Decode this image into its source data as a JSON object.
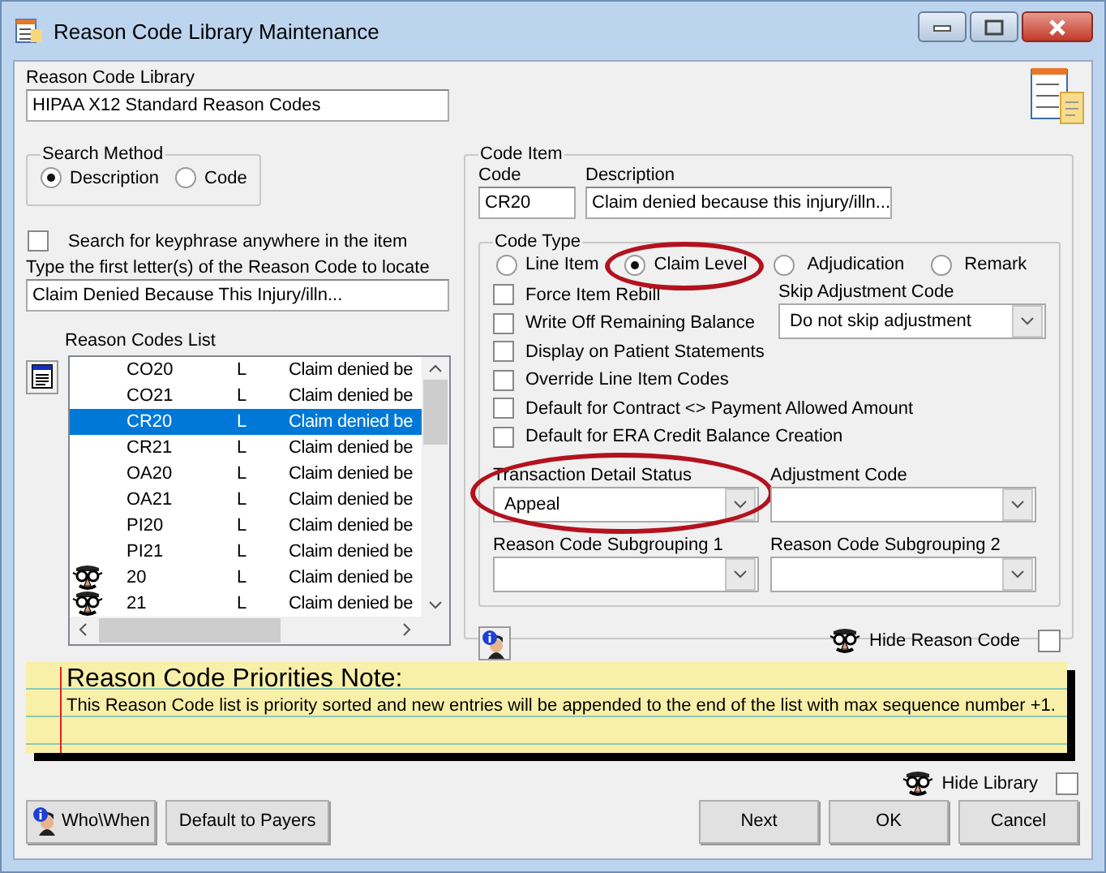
{
  "window": {
    "title": "Reason Code Library Maintenance"
  },
  "library": {
    "label": "Reason Code Library",
    "value": "HIPAA X12 Standard Reason Codes"
  },
  "search_method": {
    "title": "Search Method",
    "options": [
      {
        "label": "Description",
        "selected": true
      },
      {
        "label": "Code",
        "selected": false
      }
    ]
  },
  "keyphrase": {
    "label": "Search for keyphrase anywhere in the item",
    "checked": false
  },
  "locate": {
    "label": "Type the first letter(s) of the Reason Code to locate",
    "value": "Claim Denied Because This Injury/illn..."
  },
  "codes_list": {
    "title": "Reason Codes List",
    "rows": [
      {
        "code": "CO20",
        "type": "L",
        "description": "Claim denied be",
        "selected": false,
        "hidden": false
      },
      {
        "code": "CO21",
        "type": "L",
        "description": "Claim denied be",
        "selected": false,
        "hidden": false
      },
      {
        "code": "CR20",
        "type": "L",
        "description": "Claim denied be",
        "selected": true,
        "hidden": false
      },
      {
        "code": "CR21",
        "type": "L",
        "description": "Claim denied be",
        "selected": false,
        "hidden": false
      },
      {
        "code": "OA20",
        "type": "L",
        "description": "Claim denied be",
        "selected": false,
        "hidden": false
      },
      {
        "code": "OA21",
        "type": "L",
        "description": "Claim denied be",
        "selected": false,
        "hidden": false
      },
      {
        "code": "PI20",
        "type": "L",
        "description": "Claim denied be",
        "selected": false,
        "hidden": false
      },
      {
        "code": "PI21",
        "type": "L",
        "description": "Claim denied be",
        "selected": false,
        "hidden": false
      },
      {
        "code": "20",
        "type": "L",
        "description": "Claim denied be",
        "selected": false,
        "hidden": true
      },
      {
        "code": "21",
        "type": "L",
        "description": "Claim denied be",
        "selected": false,
        "hidden": true
      }
    ]
  },
  "code_item": {
    "title": "Code Item",
    "code_label": "Code",
    "code": "CR20",
    "description_label": "Description",
    "description": "Claim denied because this injury/illn...",
    "code_type": {
      "title": "Code Type",
      "options": [
        {
          "label": "Line Item",
          "selected": false,
          "highlight": false
        },
        {
          "label": "Claim Level",
          "selected": true,
          "highlight": true
        },
        {
          "label": "Adjudication",
          "selected": false,
          "highlight": false
        },
        {
          "label": "Remark",
          "selected": false,
          "highlight": false
        }
      ],
      "checkboxes": [
        {
          "label": "Force Item Rebill",
          "checked": false
        },
        {
          "label": "Write Off Remaining Balance",
          "checked": false
        },
        {
          "label": "Display on Patient Statements",
          "checked": false
        },
        {
          "label": "Override Line Item Codes",
          "checked": false
        },
        {
          "label": "Default for Contract <> Payment Allowed Amount",
          "checked": false
        },
        {
          "label": "Default for ERA Credit Balance Creation",
          "checked": false
        }
      ],
      "skip_adjustment": {
        "label": "Skip Adjustment Code",
        "value": "Do not skip adjustment"
      },
      "dropdowns": [
        {
          "label": "Transaction Detail Status",
          "value": "Appeal",
          "highlight": true
        },
        {
          "label": "Adjustment Code",
          "highlight": false
        },
        {
          "label": "Reason Code Subgrouping 1",
          "highlight": false
        },
        {
          "label": "Reason Code Subgrouping 2",
          "highlight": false
        }
      ]
    },
    "hide_reason_code": {
      "label": "Hide Reason Code",
      "checked": false
    }
  },
  "note": {
    "title": "Reason Code Priorities Note:",
    "text": "This Reason Code list is priority sorted and new entries will be appended to the end of the list with max sequence number +1."
  },
  "hide_library": {
    "label": "Hide Library",
    "checked": false
  },
  "buttons_left": [
    {
      "label": "Who\\When",
      "kind": "info"
    },
    {
      "label": "Default to Payers",
      "kind": "plain"
    }
  ],
  "buttons_right": [
    {
      "label": "Next"
    },
    {
      "label": "OK"
    },
    {
      "label": "Cancel"
    }
  ]
}
